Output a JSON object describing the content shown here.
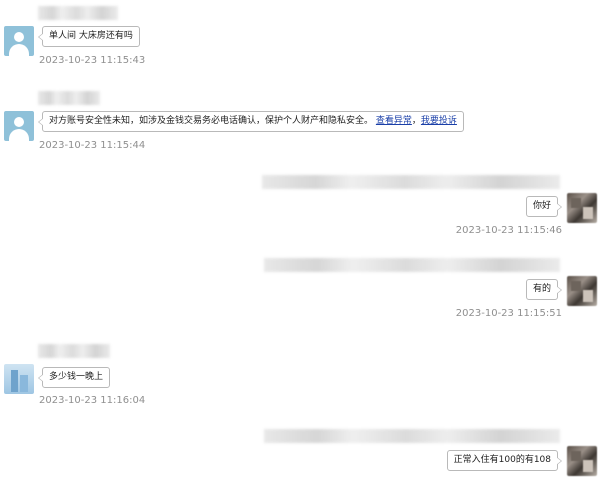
{
  "messages": [
    {
      "side": "left",
      "text": "单人间 大床房还有吗",
      "time": "2023-10-23 11:15:43"
    },
    {
      "side": "left",
      "text": "对方账号安全性未知，如涉及金钱交易务必电话确认，保护个人财产和隐私安全。",
      "links": [
        "查看异常",
        "我要投诉"
      ],
      "time": "2023-10-23 11:15:44"
    },
    {
      "side": "right",
      "text": "你好",
      "time": "2023-10-23 11:15:46"
    },
    {
      "side": "right",
      "text": "有的",
      "time": "2023-10-23 11:15:51"
    },
    {
      "side": "left",
      "text": "多少钱一晚上",
      "time": "2023-10-23 11:16:04"
    },
    {
      "side": "right",
      "text": "正常入住有100的有108",
      "time": ""
    }
  ]
}
